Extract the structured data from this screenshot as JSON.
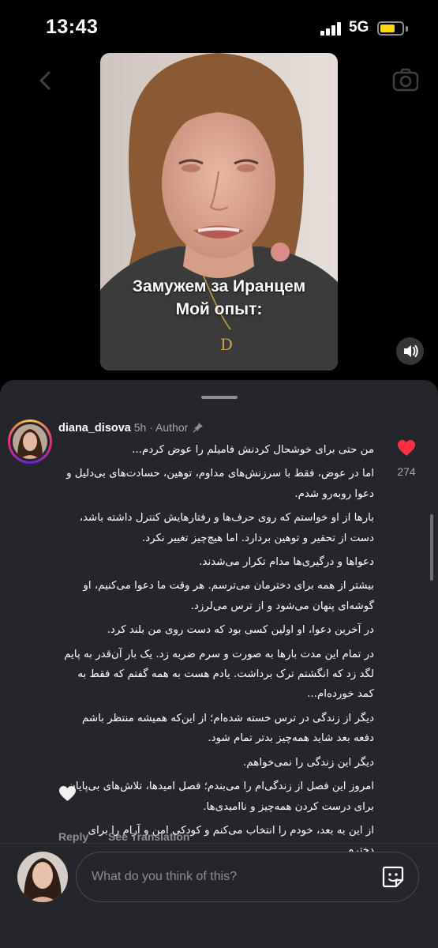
{
  "status_bar": {
    "time": "13:43",
    "network": "5G"
  },
  "video": {
    "caption_lines": [
      "Замужем за Иранцем",
      "Мой опыт:"
    ],
    "sound_icon": "speaker-icon"
  },
  "comment": {
    "username": "diana_disova",
    "time_ago": "5h",
    "separator": "·",
    "author_label": "Author",
    "like_count": "274",
    "liked": true,
    "paragraphs": [
      "من حتی برای خوشحال کردنش فامیلم را عوض کردم...",
      "اما در عوض، فقط با سرزنش‌های مداوم، توهین، حسادت‌های بی‌دلیل و دعوا روبه‌رو شدم.",
      "بارها از او خواستم که روی حرف‌ها و رفتارهایش کنترل داشته باشد، دست از تحقیر و توهین بردارد. اما هیچ‌چیز تغییر نکرد.",
      "دعواها و درگیری‌ها مدام تکرار می‌شدند.",
      "بیشتر از همه برای دخترمان می‌ترسم. هر وقت ما دعوا می‌کنیم، او گوشه‌ای پنهان می‌شود و از ترس می‌لرزد.",
      "در آخرین دعوا، او اولین کسی بود که دست روی من بلند کرد.",
      "در تمام این مدت بارها به صورت و سرم ضربه زد. یک بار آن‌قدر به پایم لگد زد که انگشتم ترک برداشت. یادم هست به همه گفتم که فقط به کمد خورده‌ام...",
      "دیگر از زندگی در ترس خسته شده‌ام؛ از این‌که همیشه منتظر باشم دفعه بعد شاید همه‌چیز بدتر تمام شود.",
      "دیگر این زندگی را نمی‌خواهم.",
      "امروز این فصل از زندگی‌ام را می‌بندم؛ فصل امیدها، تلاش‌های بی‌پایان برای درست کردن همه‌چیز و ناامیدی‌ها.",
      "از این به بعد، خودم را انتخاب می‌کنم و کودکی امن و آرام را برای دخترم."
    ],
    "reply_label": "Reply",
    "translate_label": "See Translation"
  },
  "composer": {
    "placeholder": "What do you think of this?"
  },
  "colors": {
    "sheet_bg": "#25262b",
    "like_red": "#ff3040",
    "muted_text": "#8e8e93",
    "battery_yellow": "#ffd60a"
  }
}
